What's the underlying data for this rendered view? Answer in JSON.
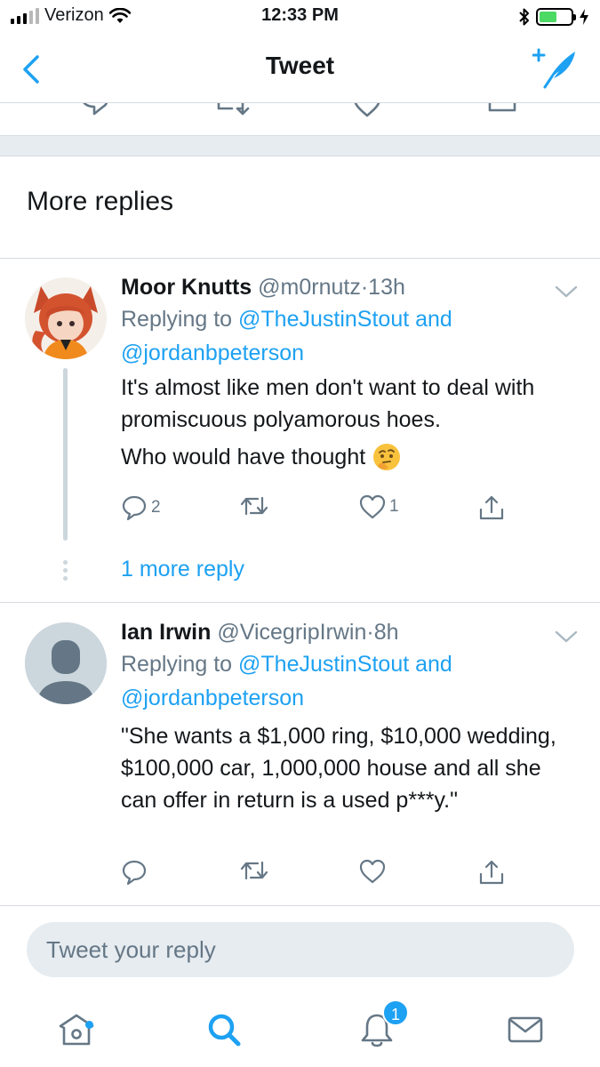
{
  "status_bar": {
    "carrier": "Verizon",
    "time": "12:33 PM"
  },
  "nav": {
    "title": "Tweet"
  },
  "section": {
    "more_replies": "More replies"
  },
  "replies": [
    {
      "name": "Moor Knutts",
      "handle": "@m0rnutz",
      "dot": "·",
      "time": "13h",
      "replying_prefix": "Replying to ",
      "mention_1": "@TheJustinStout",
      "mention_joiner": " and",
      "mention_2": "@jordanbpeterson",
      "text_1": "It's almost like men don't want to deal with promiscuous polyamorous hoes.",
      "text_2": "Who would have thought",
      "emoji": "thinking-face-emoji",
      "reply_count": "2",
      "retweet_count": "",
      "like_count": "1",
      "more_replies_link": "1 more reply"
    },
    {
      "name": "Ian Irwin",
      "handle": "@VicegripIrwin",
      "dot": "·",
      "time": "8h",
      "replying_prefix": "Replying to ",
      "mention_1": "@TheJustinStout",
      "mention_joiner": " and",
      "mention_2": "@jordanbpeterson",
      "text_1": "\"She wants a $1,000 ring, $10,000 wedding, $100,000 car, 1,000,000 house and all she can offer in return is a used p***y.\"",
      "reply_count": "",
      "retweet_count": "",
      "like_count": ""
    }
  ],
  "composer": {
    "placeholder": "Tweet your reply"
  },
  "tab_bar": {
    "notifications_badge": "1"
  },
  "colors": {
    "accent": "#1da1f2",
    "muted": "#657786",
    "divider": "#d6dbe0",
    "separator_bg": "#e6ecf0"
  }
}
